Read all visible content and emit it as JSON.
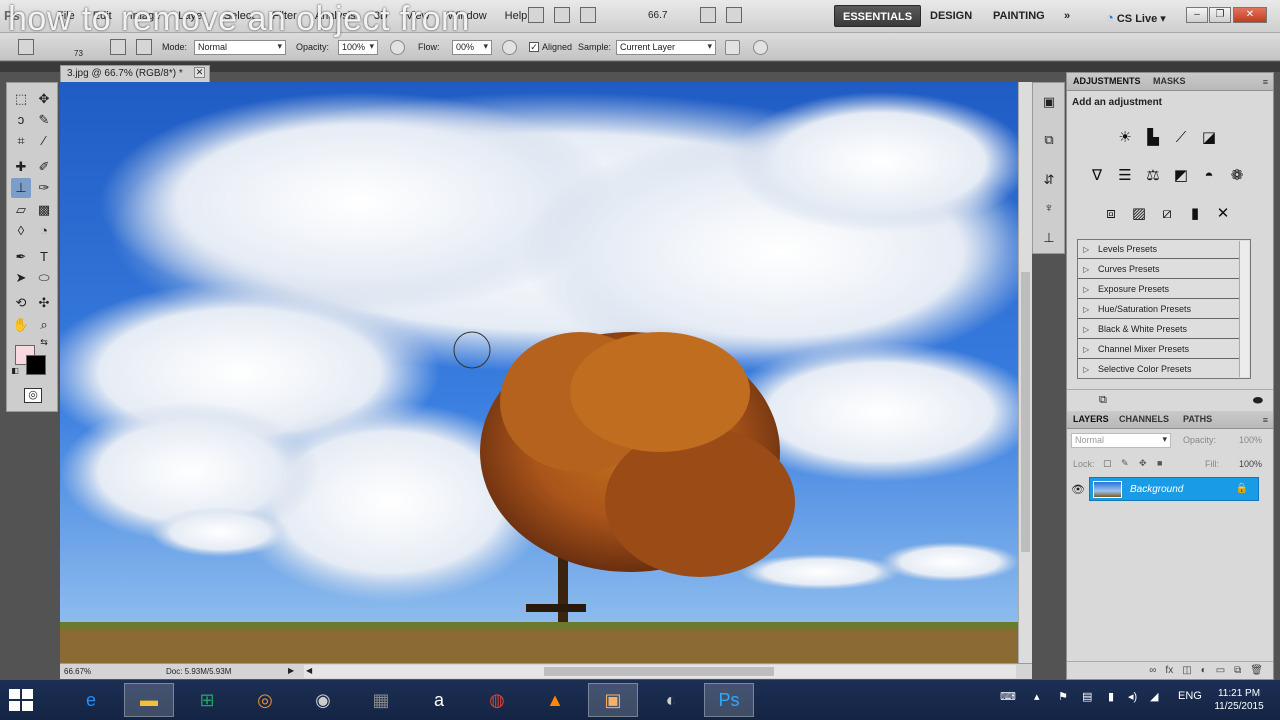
{
  "overlay_title": "how to remove an object from",
  "menubar": {
    "logo": "Ps",
    "menus": [
      "File",
      "Edit",
      "Image",
      "Layer",
      "Select",
      "Filter",
      "Analysis",
      "3D",
      "View",
      "Window",
      "Help"
    ],
    "zoom": "66.7",
    "workspaces": [
      "ESSENTIALS",
      "DESIGN",
      "PAINTING"
    ],
    "more": "»",
    "cs_live": "CS Live",
    "win_min": "–",
    "win_restore": "❐",
    "win_close": "✕"
  },
  "options": {
    "brush_size": "73",
    "mode_label": "Mode:",
    "mode_value": "Normal",
    "opacity_label": "Opacity:",
    "opacity_value": "100%",
    "flow_label": "Flow:",
    "flow_value": "00%",
    "aligned_check": "✓",
    "aligned_label": "Aligned",
    "sample_label": "Sample:",
    "sample_value": "Current Layer"
  },
  "document": {
    "tab_title": "3.jpg @ 66.7% (RGB/8*) *",
    "tab_close": "✕",
    "status_zoom": "66.67%",
    "status_doc": "Doc: 5.93M/5.93M",
    "nav_right": "▶",
    "nav_left": "◀"
  },
  "adjustments": {
    "tab_adjustments": "ADJUSTMENTS",
    "tab_masks": "MASKS",
    "menu_glyph": "≡",
    "heading": "Add an adjustment",
    "presets": [
      "Levels Presets",
      "Curves Presets",
      "Exposure Presets",
      "Hue/Saturation Presets",
      "Black & White Presets",
      "Channel Mixer Presets",
      "Selective Color Presets"
    ]
  },
  "layers": {
    "tab_layers": "LAYERS",
    "tab_channels": "CHANNELS",
    "tab_paths": "PATHS",
    "menu_glyph": "≡",
    "blend_mode": "Normal",
    "opacity_label": "Opacity:",
    "opacity_value": "100%",
    "lock_label": "Lock:",
    "fill_label": "Fill:",
    "fill_value": "100%",
    "layer_name": "Background",
    "eye_glyph": "👁",
    "lock_glyph": "🔒"
  },
  "taskbar": {
    "language": "ENG",
    "time": "11:21 PM",
    "date": "11/25/2015",
    "apps": [
      {
        "icon": "e",
        "color": "#1e90ff"
      },
      {
        "icon": "▬",
        "color": "#f1c232"
      },
      {
        "icon": "⊞",
        "color": "#21a366"
      },
      {
        "icon": "◎",
        "color": "#e69138"
      },
      {
        "icon": "◉",
        "color": "#cccccc"
      },
      {
        "icon": "▦",
        "color": "#888888"
      },
      {
        "icon": "a",
        "color": "#ffffff"
      },
      {
        "icon": "◍",
        "color": "#db4437"
      },
      {
        "icon": "▲",
        "color": "#ff8800"
      },
      {
        "icon": "▣",
        "color": "#f6b26b"
      },
      {
        "icon": "◐",
        "color": "#cccccc"
      },
      {
        "icon": "Ps",
        "color": "#31a8ff"
      }
    ]
  },
  "colors": {
    "foreground": "#f7d9df",
    "background": "#000000",
    "layer_selected": "#1a9be6",
    "sky": "#2e69c8"
  }
}
